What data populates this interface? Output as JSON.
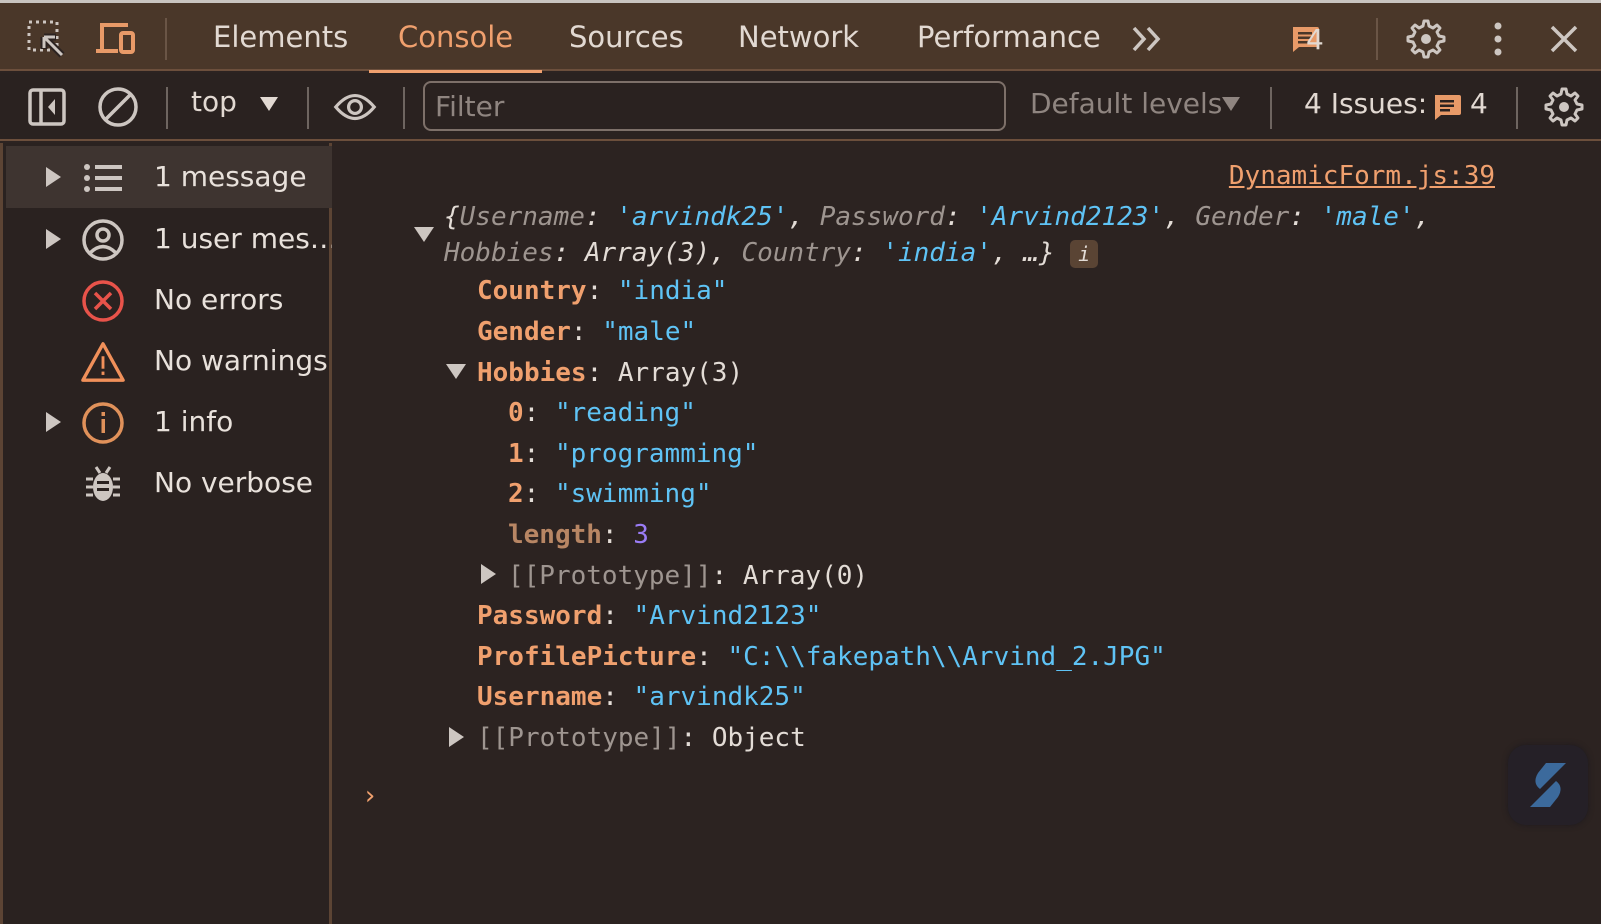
{
  "tabbar": {
    "tabs": [
      {
        "label": "Elements"
      },
      {
        "label": "Console",
        "active": true
      },
      {
        "label": "Sources"
      },
      {
        "label": "Network"
      },
      {
        "label": "Performance"
      }
    ],
    "more_tabs_icon": "chevrons-right-icon",
    "issues_badge_count": "4",
    "accent_color": "#f0a06e"
  },
  "toolbar": {
    "context": "top",
    "filter_placeholder": "Filter",
    "filter_value": "",
    "levels": "Default levels",
    "issues_label": "4 Issues:",
    "issues_count": "4"
  },
  "sidebar": {
    "items": [
      {
        "label": "1 message",
        "icon": "list-icon",
        "expandable": true,
        "selected": true
      },
      {
        "label": "1 user mes…",
        "icon": "user-icon",
        "expandable": true
      },
      {
        "label": "No errors",
        "icon": "error-icon",
        "expandable": false
      },
      {
        "label": "No warnings",
        "icon": "warning-icon",
        "expandable": false
      },
      {
        "label": "1 info",
        "icon": "info-icon",
        "expandable": true
      },
      {
        "label": "No verbose",
        "icon": "bug-icon",
        "expandable": false
      }
    ]
  },
  "console": {
    "source_link": "DynamicForm.js:39",
    "summary": {
      "open_brace": "{",
      "k1": "Username",
      "v1": "'arvindk25'",
      "k2": "Password",
      "v2": "'Arvind2123'",
      "k3": "Gender",
      "v3": "'male'",
      "k4": "Hobbies",
      "v4": "Array(3)",
      "k5": "Country",
      "v5": "'india'",
      "ellipsis": "…}",
      "badge": "i"
    },
    "properties": [
      {
        "key": "Country",
        "value": "\"india\""
      },
      {
        "key": "Gender",
        "value": "\"male\""
      },
      {
        "key": "Hobbies",
        "value": "Array(3)"
      },
      {
        "key": "Password",
        "value": "\"Arvind2123\""
      },
      {
        "key": "ProfilePicture",
        "value": "\"C:\\\\fakepath\\\\Arvind_2.JPG\""
      },
      {
        "key": "Username",
        "value": "\"arvindk25\""
      }
    ],
    "hobbies": [
      {
        "index": "0",
        "value": "\"reading\""
      },
      {
        "index": "1",
        "value": "\"programming\""
      },
      {
        "index": "2",
        "value": "\"swimming\""
      }
    ],
    "hobbies_length_key": "length",
    "hobbies_length": "3",
    "array_proto_key": "[[Prototype]]",
    "array_proto_value": "Array(0)",
    "object_proto_key": "[[Prototype]]",
    "object_proto_value": "Object",
    "prompt": "›"
  }
}
